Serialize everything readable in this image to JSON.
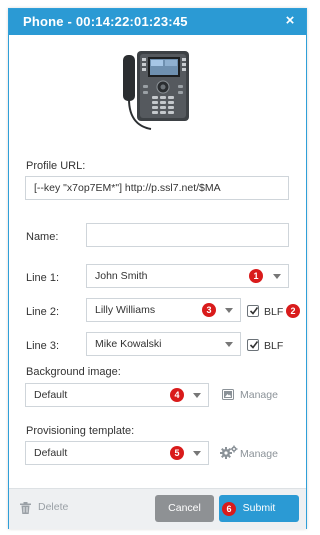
{
  "dialog": {
    "title": "Phone - 00:14:22:01:23:45",
    "close_label": "×"
  },
  "form": {
    "profile_url": {
      "label": "Profile URL:",
      "value": "[--key \"x7op7EM*\"] http://p.ssl7.net/$MA"
    },
    "name": {
      "label": "Name:",
      "value": ""
    },
    "line1": {
      "label": "Line 1:",
      "value": "John Smith",
      "badge": "1"
    },
    "line2": {
      "label": "Line 2:",
      "value": "Lilly Williams",
      "badge": "3",
      "blf_label": "BLF",
      "blf_checked": true,
      "blf_badge": "2"
    },
    "line3": {
      "label": "Line 3:",
      "value": "Mike Kowalski",
      "blf_label": "BLF",
      "blf_checked": true
    },
    "background_image": {
      "label": "Background image:",
      "value": "Default",
      "badge": "4",
      "manage_label": "Manage"
    },
    "provisioning_template": {
      "label": "Provisioning template:",
      "value": "Default",
      "badge": "5",
      "manage_label": "Manage"
    }
  },
  "footer": {
    "delete_label": "Delete",
    "cancel_label": "Cancel",
    "submit_label": "Submit",
    "submit_badge": "6"
  },
  "colors": {
    "accent": "#2b9ad4",
    "badge": "#d91b1b",
    "cancel": "#8e9194"
  }
}
